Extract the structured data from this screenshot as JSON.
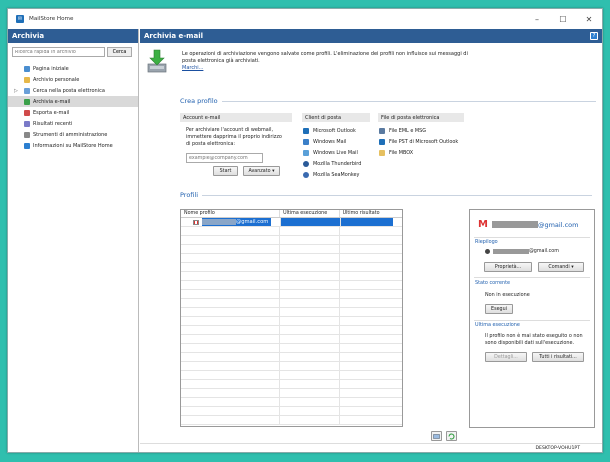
{
  "window": {
    "title": "MailStore Home"
  },
  "sidebar": {
    "header": "Archivia",
    "search_placeholder": "Ricerca rapida in archivio",
    "search_button": "Cerca",
    "items": [
      {
        "label": "Pagina iniziale",
        "color": "#4a8ed0"
      },
      {
        "label": "Archivio personale",
        "color": "#e6b84a"
      },
      {
        "label": "Cerca nella posta elettronica",
        "color": "#6a9fd8"
      },
      {
        "label": "Archivia e-mail",
        "color": "#3aa04a"
      },
      {
        "label": "Esporta e-mail",
        "color": "#d04a4a"
      },
      {
        "label": "Risultati recenti",
        "color": "#7a7ac8"
      },
      {
        "label": "Strumenti di amministrazione",
        "color": "#888888"
      },
      {
        "label": "Informazioni su MailStore Home",
        "color": "#2c7fd0"
      }
    ],
    "expand_glyph": "▷"
  },
  "main": {
    "header": "Archivia e-mail",
    "help": "?",
    "intro": "Le operazioni di archiviazione vengono salvate come profili. L'eliminazione dei profili non influisce sui messaggi di posta elettronica già archiviati.",
    "intro_link": "Marchi...",
    "create_profile": {
      "title": "Crea profilo",
      "account_header": "Account e-mail",
      "account_text": "Per archiviare l'account di webmail, immettere dapprima il proprio indirizzo di posta elettronica:",
      "email_placeholder": "example@company.com",
      "start_button": "Start",
      "advanced_button": "Avanzato",
      "clients_header": "Client di posta",
      "clients": [
        {
          "label": "Microsoft Outlook",
          "color": "#1e6fb8"
        },
        {
          "label": "Windows Mail",
          "color": "#3a7fc8"
        },
        {
          "label": "Windows Live Mail",
          "color": "#5aa0d8"
        },
        {
          "label": "Mozilla Thunderbird",
          "color": "#2a5a98"
        },
        {
          "label": "Mozilla SeaMonkey",
          "color": "#3a6ab0"
        }
      ],
      "files_header": "File di posta elettronica",
      "files": [
        {
          "label": "File EML e MSG",
          "color": "#5a7aa0"
        },
        {
          "label": "File PST di Microsoft Outlook",
          "color": "#1e6fb8"
        },
        {
          "label": "File MBOX",
          "color": "#e6c060"
        }
      ]
    },
    "profiles": {
      "title": "Profili",
      "columns": [
        "Nome profilo",
        "Ultima esecuzione",
        "Ultimo risultato"
      ],
      "rows": [
        {
          "name": "@gmail.com",
          "last_run": "",
          "last_result": ""
        }
      ]
    },
    "detail": {
      "account": "@gmail.com",
      "summary_title": "Riepilogo",
      "summary_account": "@gmail.com",
      "properties_button": "Proprietà...",
      "commands_button": "Comandi",
      "status_title": "Stato corrente",
      "status_text": "Non in esecuzione",
      "run_button": "Esegui",
      "last_run_title": "Ultima esecuzione",
      "last_run_text": "Il profilo non è mai stato eseguito o non sono disponibili dati sull'esecuzione.",
      "details_button": "Dettagli...",
      "all_results_button": "Tutti i risultati..."
    }
  },
  "status_bar": {
    "machine": "DESKTOP-VOHU1PT"
  }
}
